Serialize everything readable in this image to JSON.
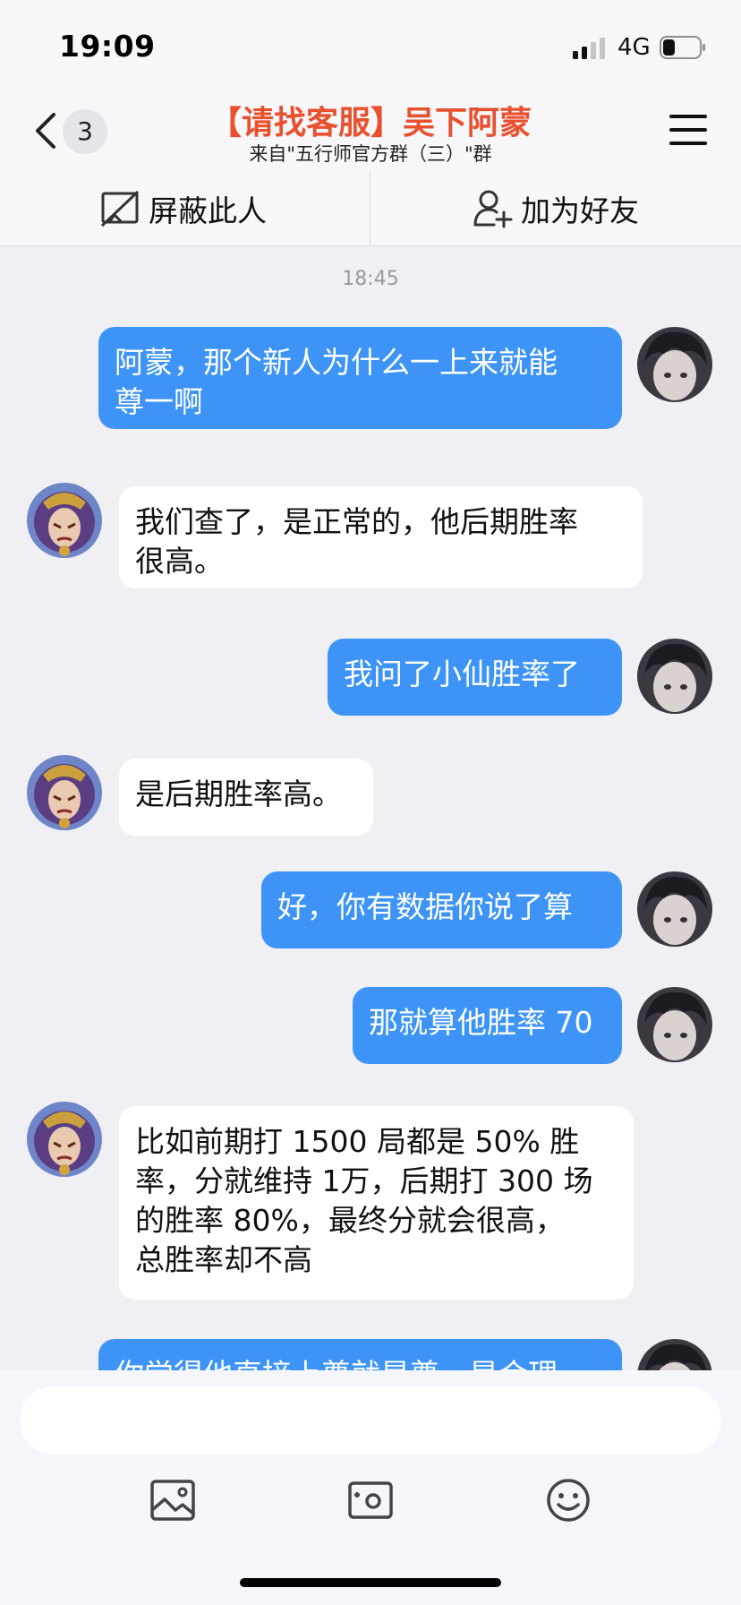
{
  "status_bar": {
    "time": "19:09",
    "network": "4G"
  },
  "header": {
    "unread_count": "3",
    "title": "【请找客服】吴下阿蒙",
    "subtitle": "来自\"五行师官方群（三）\"群",
    "colors": {
      "title": "#e8502e"
    }
  },
  "actions": {
    "block_label": "屏蔽此人",
    "add_friend_label": "加为好友"
  },
  "chat": {
    "timestamp": "18:45",
    "messages": [
      {
        "direction": "outgoing",
        "text": "阿蒙，那个新人为什么一上来就能\n尊一啊"
      },
      {
        "direction": "incoming",
        "text": "我们查了，是正常的，他后期胜率\n很高。"
      },
      {
        "direction": "outgoing",
        "text": "我问了小仙胜率了"
      },
      {
        "direction": "incoming",
        "text": "是后期胜率高。"
      },
      {
        "direction": "outgoing",
        "text": "好，你有数据你说了算"
      },
      {
        "direction": "outgoing",
        "text": "那就算他胜率 70"
      },
      {
        "direction": "incoming",
        "text": "比如前期打 1500 局都是 50% 胜\n率，分就维持 1万，后期打 300 场\n的胜率 80%，最终分就会很高，\n总胜率却不高"
      },
      {
        "direction": "outgoing",
        "text": "你觉得他直接上尊就是尊，是合理"
      }
    ],
    "colors": {
      "outgoing_bubble": "#3d94f6",
      "incoming_bubble": "#ffffff"
    }
  },
  "input": {
    "placeholder": "",
    "value": ""
  },
  "toolbar": {
    "icons": [
      "image-icon",
      "camera-icon",
      "emoji-icon"
    ]
  }
}
